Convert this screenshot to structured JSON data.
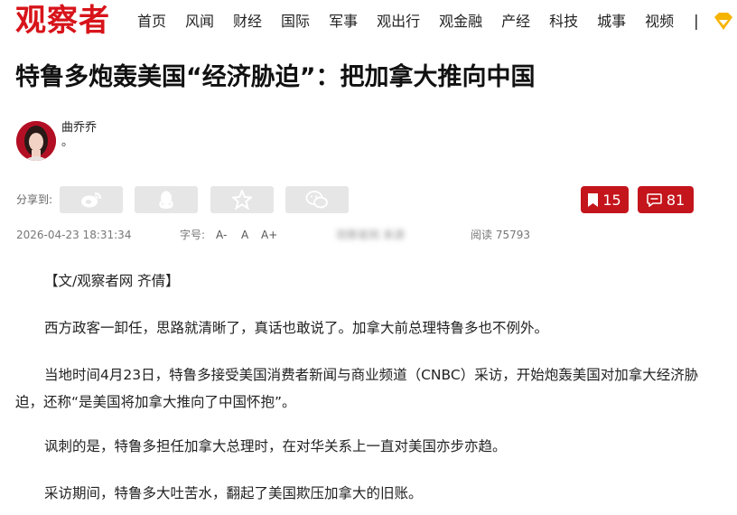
{
  "site": {
    "logo": "观察者"
  },
  "nav": {
    "items": [
      "首页",
      "风闻",
      "财经",
      "国际",
      "军事",
      "观出行",
      "观金融",
      "产经",
      "科技",
      "城事",
      "视频"
    ],
    "separator": "|",
    "vip_icon": "vip-diamond-icon"
  },
  "article": {
    "title": "特鲁多炮轰美国“经济胁迫”：把加拿大推向中国",
    "author": {
      "name": "曲乔乔",
      "desc": "。"
    },
    "share": {
      "label": "分享到:",
      "targets": [
        "weibo-icon",
        "qq-icon",
        "qzone-star-icon",
        "wechat-icon"
      ]
    },
    "bookmarks": "15",
    "comments": "81",
    "date": "2026-04-23 18:31:34",
    "font_label": "字号:",
    "font_options": [
      "A-",
      "A",
      "A+"
    ],
    "blurred": "观察者网 来源",
    "reads": "阅读 75793",
    "paragraphs": [
      "【文/观察者网 齐倩】",
      "西方政客一卸任，思路就清晰了，真话也敢说了。加拿大前总理特鲁多也不例外。",
      "当地时间4月23日，特鲁多接受美国消费者新闻与商业频道（CNBC）采访，开始炮轰美国对加拿大经济胁迫，还称“是美国将加拿大推向了中国怀抱”。",
      "讽刺的是，特鲁多担任加拿大总理时，在对华关系上一直对美国亦步亦趋。",
      "采访期间，特鲁多大吐苦水，翻起了美国欺压加拿大的旧账。"
    ]
  },
  "colors": {
    "brand": "#d7141a",
    "button": "#c4151c",
    "share_bg": "#e6e6e6"
  }
}
